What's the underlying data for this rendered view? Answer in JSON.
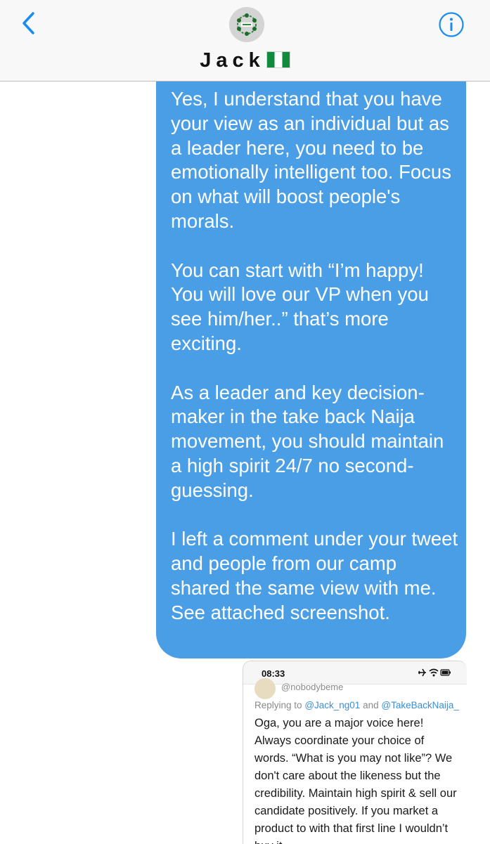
{
  "header": {
    "contact_name": "Jack",
    "back_icon": "chevron-left-icon",
    "info_icon": "info-icon",
    "accent": "#1a8cf0"
  },
  "message": {
    "bubble_color": "#4a9ee6",
    "text": "Yes, I understand that you have your view as an individual but as a leader here, you need to be emotionally intelligent too. Focus on what will boost people's morals.\n\nYou can start with “I’m happy! You will love our VP when you see him/her..” that’s more exciting.\n\nAs a leader and key decision-maker in the take back Naija movement, you should maintain a high spirit 24/7 no second-guessing.\n\nI left a comment under your tweet and people from our camp shared the same view with me. See attached screenshot."
  },
  "attachment": {
    "time": "08:33",
    "handle": "@nobodybeme",
    "replying_prefix": "Replying to",
    "reply_mention_1": "@Jack_ng01",
    "reply_and": "and",
    "reply_mention_2": "@TakeBackNaija_",
    "body": "Oga, you are a major voice here! Always coordinate your choice of words. “What is you may not like”? We don't care about the likeness but the credibility. Maintain high spirit & sell our candidate positively. If you market a product to with that first line I wouldn’t buy it."
  }
}
